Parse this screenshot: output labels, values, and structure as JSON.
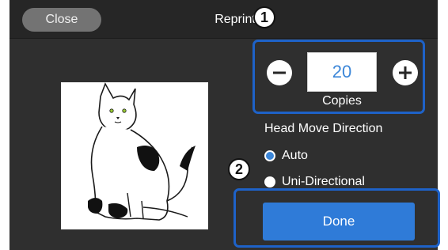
{
  "header": {
    "close_label": "Close",
    "title": "Reprint"
  },
  "copies": {
    "value": "20",
    "label": "Copies",
    "minus_icon": "minus-circle-icon",
    "plus_icon": "plus-circle-icon"
  },
  "head_move": {
    "label": "Head Move Direction",
    "options": [
      {
        "label": "Auto",
        "selected": true
      },
      {
        "label": "Uni-Directional",
        "selected": false
      }
    ]
  },
  "done_label": "Done",
  "callouts": [
    "1",
    "2"
  ],
  "colors": {
    "accent": "#2f7bd8",
    "callout_border": "#1e62c8",
    "panel_bg": "#2f2f2f",
    "topbar_bg": "#262626"
  },
  "preview_icon": "cat-illustration"
}
